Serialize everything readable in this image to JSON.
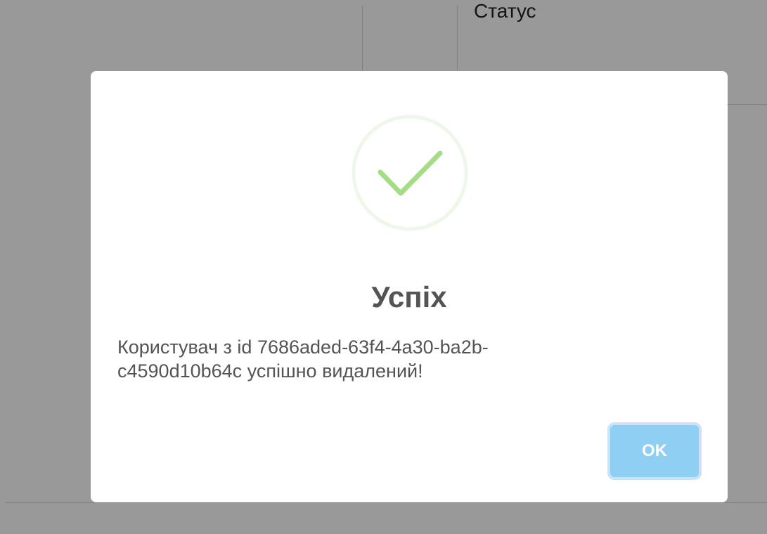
{
  "background_table": {
    "header_status": "Статус"
  },
  "modal": {
    "title": "Успіх",
    "message": "Користувач з id 7686aded-63f4-4a30-ba2b-c4590d10b64c успішно видалений!",
    "ok_label": "OK",
    "icon": "check-icon",
    "accent_color": "#a5dc86",
    "button_color": "#8ecff3"
  }
}
